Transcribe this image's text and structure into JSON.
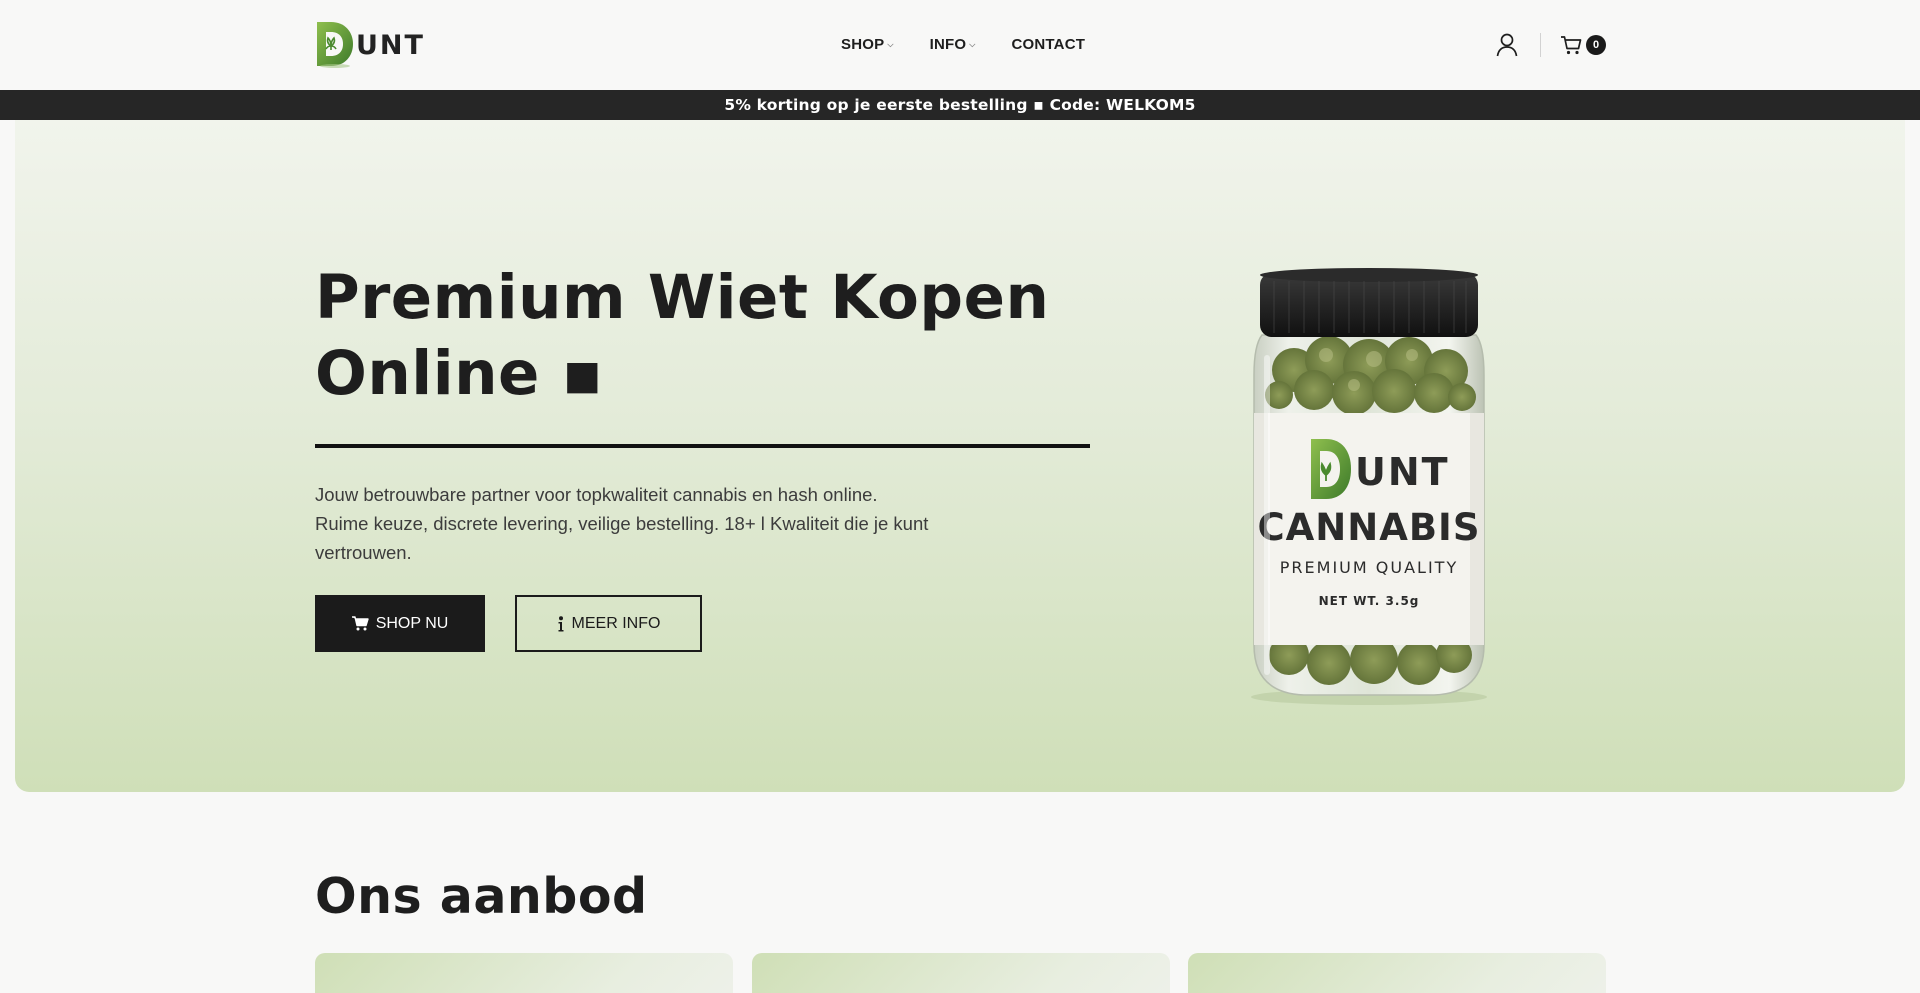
{
  "header": {
    "logo_text": "UNT",
    "nav": [
      {
        "label": "SHOP",
        "has_dropdown": true
      },
      {
        "label": "INFO",
        "has_dropdown": true
      },
      {
        "label": "CONTACT",
        "has_dropdown": false
      }
    ],
    "account_icon": "user-icon",
    "cart_icon": "cart-icon",
    "cart_count": "0"
  },
  "promo": {
    "text": "5% korting op je eerste bestelling ▪ Code: WELKOM5"
  },
  "hero": {
    "title_line1": "Premium Wiet Kopen",
    "title_line2": "Online ▪",
    "desc_line1": "Jouw betrouwbare partner voor topkwaliteit cannabis en hash online.",
    "desc_line2": "Ruime keuze, discrete levering, veilige bestelling. 18+ l Kwaliteit die je kunt",
    "desc_line3": "vertrouwen.",
    "primary_button": "SHOP NU",
    "secondary_button": "MEER INFO",
    "product_label": {
      "brand": "UNT",
      "name": "CANNABIS",
      "tagline": "PREMIUM QUALITY",
      "weight": "NET WT. 3.5g"
    }
  },
  "section": {
    "title": "Ons aanbod",
    "card_count": 3
  },
  "colors": {
    "brand_green": "#5f9a3a",
    "dark": "#1b1b1b",
    "hero_top": "#f1f4ec",
    "hero_bottom": "#cfdfb8"
  }
}
